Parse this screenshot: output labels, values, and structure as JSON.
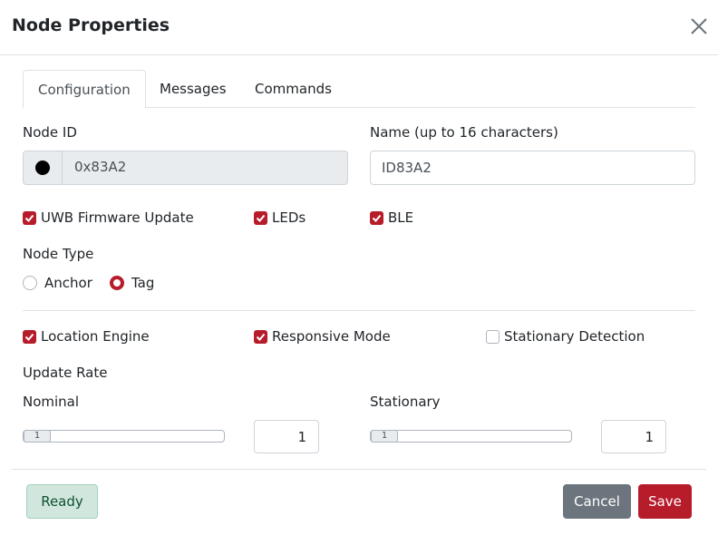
{
  "dialog": {
    "title": "Node Properties"
  },
  "tabs": [
    {
      "label": "Configuration",
      "active": true
    },
    {
      "label": "Messages",
      "active": false
    },
    {
      "label": "Commands",
      "active": false
    }
  ],
  "node_id": {
    "label": "Node ID",
    "value": "0x83A2",
    "status_color": "#000000"
  },
  "name": {
    "label": "Name (up to 16 characters)",
    "value": "ID83A2"
  },
  "features": [
    {
      "label": "UWB Firmware Update",
      "checked": true
    },
    {
      "label": "LEDs",
      "checked": true
    },
    {
      "label": "BLE",
      "checked": true
    }
  ],
  "node_type": {
    "label": "Node Type",
    "options": [
      {
        "label": "Anchor",
        "selected": false
      },
      {
        "label": "Tag",
        "selected": true
      }
    ]
  },
  "modes": [
    {
      "label": "Location Engine",
      "checked": true
    },
    {
      "label": "Responsive Mode",
      "checked": true
    },
    {
      "label": "Stationary Detection",
      "checked": false
    }
  ],
  "update_rate": {
    "label": "Update Rate",
    "nominal": {
      "label": "Nominal",
      "slider_value": "1",
      "input_value": "1"
    },
    "stationary": {
      "label": "Stationary",
      "slider_value": "1",
      "input_value": "1"
    }
  },
  "footer": {
    "status": "Ready",
    "cancel": "Cancel",
    "save": "Save"
  },
  "colors": {
    "accent": "#b71c2b",
    "secondary": "#6c757d",
    "success_bg": "#d1e7dd",
    "success_text": "#0f5132"
  }
}
